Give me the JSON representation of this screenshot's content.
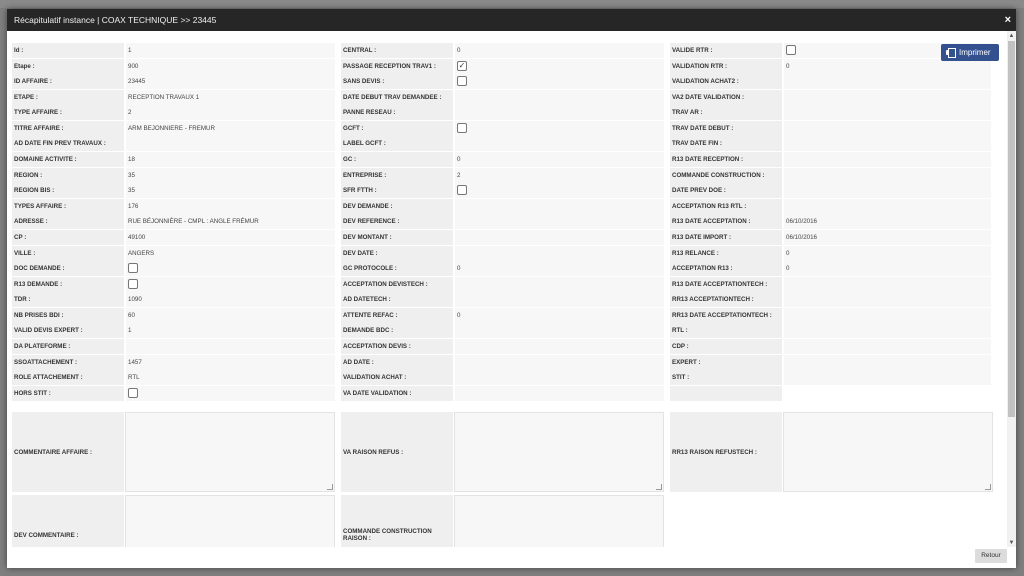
{
  "title": "Récapitulatif instance | COAX TECHNIQUE >> 23445",
  "close_symbol": "×",
  "print_label": "Imprimer",
  "back_label": "Retour",
  "columns": [
    [
      {
        "label": "Id :",
        "value": "1"
      },
      {
        "label": "Etape :",
        "value": "900"
      },
      {
        "label": "ID AFFAIRE :",
        "value": "23445"
      },
      {
        "label": "ETAPE :",
        "value": "RECEPTION TRAVAUX 1"
      },
      {
        "label": "TYPE AFFAIRE :",
        "value": "2"
      },
      {
        "label": "TITRE AFFAIRE :",
        "value": "ARM BEJONNIERE - FREMUR"
      },
      {
        "label": "AD DATE FIN PREV TRAVAUX :",
        "value": ""
      },
      {
        "label": "DOMAINE ACTIVITE :",
        "value": "18"
      },
      {
        "label": "REGION :",
        "value": "35"
      },
      {
        "label": "REGION BIS :",
        "value": "35"
      },
      {
        "label": "TYPES AFFAIRE :",
        "value": "176"
      },
      {
        "label": "ADRESSE :",
        "value": "RUE BÉJONNIÈRE - CMPL : ANGLE FRÉMUR"
      },
      {
        "label": "CP :",
        "value": "49100"
      },
      {
        "label": "VILLE :",
        "value": "ANGERS"
      },
      {
        "label": "DOC DEMANDE :",
        "checkbox": true,
        "checked": false
      },
      {
        "label": "R13 DEMANDE :",
        "checkbox": true,
        "checked": false
      },
      {
        "label": "TDR :",
        "value": "1090"
      },
      {
        "label": "NB PRISES BDI :",
        "value": "60"
      },
      {
        "label": "VALID DEVIS EXPERT :",
        "value": "1"
      },
      {
        "label": "DA PLATEFORME :",
        "value": ""
      },
      {
        "label": "SSOATTACHEMENT :",
        "value": "1457"
      },
      {
        "label": "ROLE ATTACHEMENT :",
        "value": "RTL"
      },
      {
        "label": "HORS STIT :",
        "checkbox": true,
        "checked": false
      }
    ],
    [
      {
        "label": "CENTRAL :",
        "value": "0"
      },
      {
        "label": "PASSAGE RECEPTION TRAV1 :",
        "checkbox": true,
        "checked": true
      },
      {
        "label": "SANS DEVIS :",
        "checkbox": true,
        "checked": false
      },
      {
        "label": "DATE DEBUT TRAV DEMANDEE :",
        "value": ""
      },
      {
        "label": "PANNE RESEAU :",
        "value": ""
      },
      {
        "label": "GCFT :",
        "checkbox": true,
        "checked": false
      },
      {
        "label": "LABEL GCFT :",
        "value": ""
      },
      {
        "label": "GC :",
        "value": "0"
      },
      {
        "label": "ENTREPRISE :",
        "value": "2"
      },
      {
        "label": "SFR FTTH :",
        "checkbox": true,
        "checked": false
      },
      {
        "label": "DEV DEMANDE :",
        "value": ""
      },
      {
        "label": "DEV REFERENCE :",
        "value": ""
      },
      {
        "label": "DEV MONTANT :",
        "value": ""
      },
      {
        "label": "DEV DATE :",
        "value": ""
      },
      {
        "label": "GC PROTOCOLE :",
        "value": "0"
      },
      {
        "label": "ACCEPTATION DEVISTECH :",
        "value": ""
      },
      {
        "label": "AD DATETECH :",
        "value": ""
      },
      {
        "label": "ATTENTE REFAC :",
        "value": "0"
      },
      {
        "label": "DEMANDE BDC :",
        "value": ""
      },
      {
        "label": "ACCEPTATION DEVIS :",
        "value": ""
      },
      {
        "label": "AD DATE :",
        "value": ""
      },
      {
        "label": "VALIDATION ACHAT :",
        "value": ""
      },
      {
        "label": "VA DATE VALIDATION :",
        "value": ""
      }
    ],
    [
      {
        "label": "VALIDE RTR :",
        "checkbox": true,
        "checked": false
      },
      {
        "label": "VALIDATION RTR :",
        "value": "0"
      },
      {
        "label": "VALIDATION ACHAT2 :",
        "value": ""
      },
      {
        "label": "VA2 DATE VALIDATION :",
        "value": ""
      },
      {
        "label": "TRAV AR :",
        "value": ""
      },
      {
        "label": "TRAV DATE DEBUT :",
        "value": ""
      },
      {
        "label": "TRAV DATE FIN :",
        "value": ""
      },
      {
        "label": "R13 DATE RECEPTION :",
        "value": ""
      },
      {
        "label": "COMMANDE CONSTRUCTION :",
        "value": ""
      },
      {
        "label": "DATE PREV DOE :",
        "value": ""
      },
      {
        "label": "ACCEPTATION R13 RTL :",
        "value": ""
      },
      {
        "label": "R13 DATE ACCEPTATION :",
        "value": "06/10/2016"
      },
      {
        "label": "R13 DATE IMPORT :",
        "value": "06/10/2016"
      },
      {
        "label": "R13 RELANCE :",
        "value": "0"
      },
      {
        "label": "ACCEPTATION R13 :",
        "value": "0"
      },
      {
        "label": "R13 DATE ACCEPTATIONTECH :",
        "value": ""
      },
      {
        "label": "RR13 ACCEPTATIONTECH :",
        "value": ""
      },
      {
        "label": "RR13 DATE ACCEPTATIONTECH :",
        "value": ""
      },
      {
        "label": "RTL :",
        "value": ""
      },
      {
        "label": "CDP :",
        "value": ""
      },
      {
        "label": "EXPERT :",
        "value": ""
      },
      {
        "label": "STIT :",
        "value": ""
      },
      {
        "label": "",
        "value": "",
        "empty": true
      }
    ]
  ],
  "textareas": [
    {
      "label": "COMMENTAIRE AFFAIRE :",
      "value": ""
    },
    {
      "label": "VA RAISON REFUS :",
      "value": ""
    },
    {
      "label": "RR13 RAISON REFUSTECH :",
      "value": ""
    },
    {
      "label": "DEV COMMENTAIRE :",
      "value": ""
    },
    {
      "label": "COMMANDE CONSTRUCTION RAISON :",
      "value": ""
    }
  ],
  "colors": {
    "header_bg": "#262626",
    "print_button": "#33518e",
    "label_bg": "#efefef",
    "value_bg": "#f7f7f7"
  }
}
